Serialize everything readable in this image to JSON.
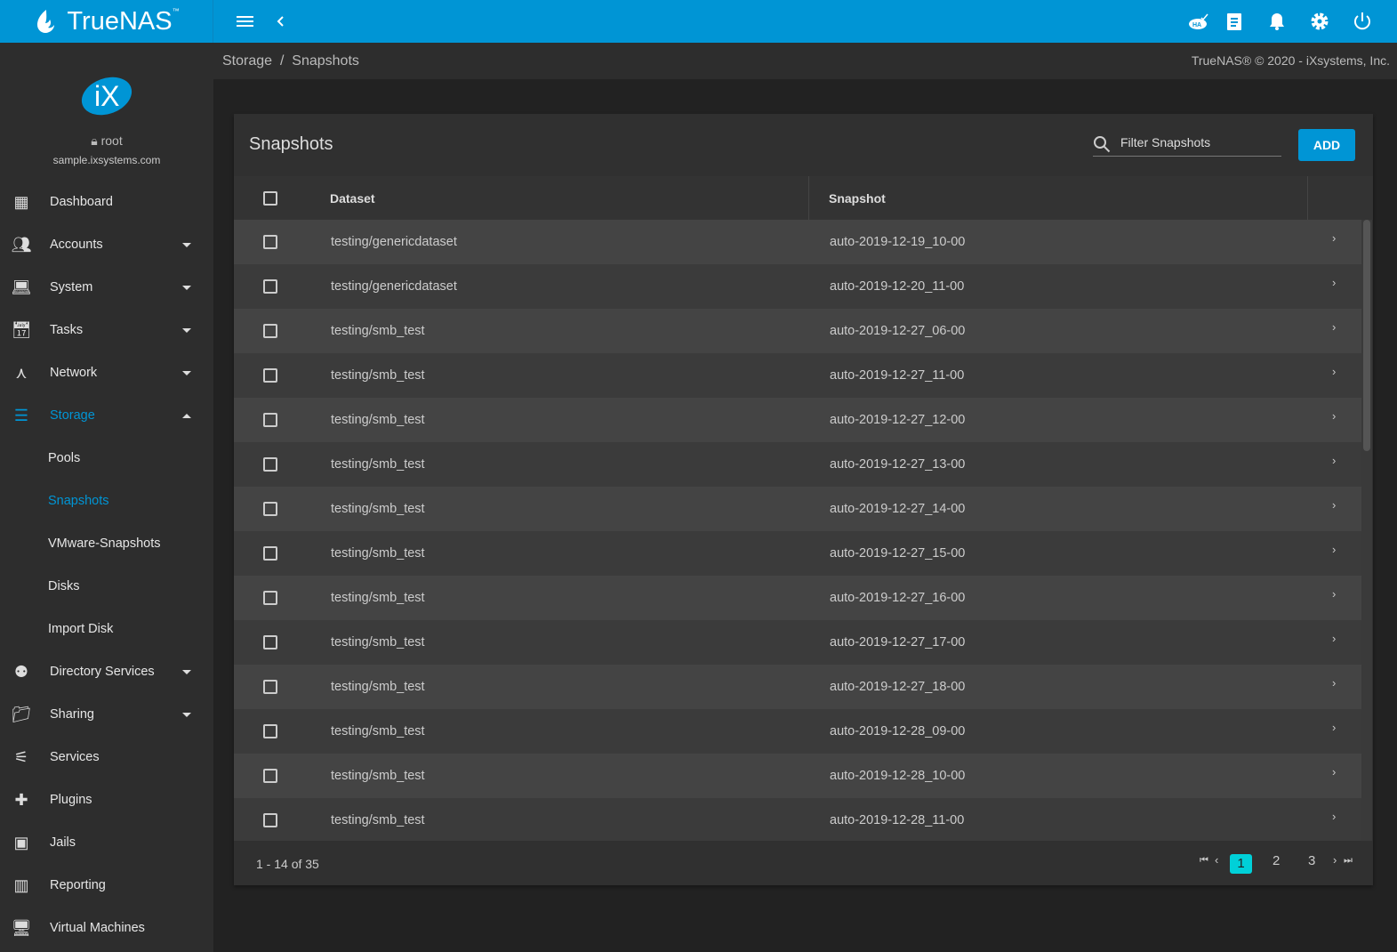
{
  "topbar": {
    "brand": "TrueNAS",
    "trademark": "™",
    "icons": [
      "ha-icon",
      "clipboard-icon",
      "bell-icon",
      "gear-icon",
      "power-icon"
    ],
    "accent": "#0095d5"
  },
  "profile": {
    "logo": "iX",
    "user": "root",
    "host": "sample.ixsystems.com"
  },
  "sidebar": {
    "items": [
      {
        "label": "Dashboard",
        "icon": "dashboard-icon"
      },
      {
        "label": "Accounts",
        "icon": "accounts-icon",
        "expandable": true
      },
      {
        "label": "System",
        "icon": "laptop-icon",
        "expandable": true
      },
      {
        "label": "Tasks",
        "icon": "calendar-icon",
        "expandable": true
      },
      {
        "label": "Network",
        "icon": "network-icon",
        "expandable": true
      },
      {
        "label": "Storage",
        "icon": "storage-icon",
        "expandable": true,
        "expanded": true,
        "active": true
      },
      {
        "label": "Directory Services",
        "icon": "directory-icon",
        "expandable": true
      },
      {
        "label": "Sharing",
        "icon": "folder-shared-icon",
        "expandable": true
      },
      {
        "label": "Services",
        "icon": "tune-icon"
      },
      {
        "label": "Plugins",
        "icon": "puzzle-icon"
      },
      {
        "label": "Jails",
        "icon": "jail-icon"
      },
      {
        "label": "Reporting",
        "icon": "chart-icon"
      },
      {
        "label": "Virtual Machines",
        "icon": "computer-icon"
      }
    ],
    "storage_sub": [
      {
        "label": "Pools"
      },
      {
        "label": "Snapshots",
        "active": true
      },
      {
        "label": "VMware-Snapshots"
      },
      {
        "label": "Disks"
      },
      {
        "label": "Import Disk"
      }
    ]
  },
  "breadcrumb": {
    "parent": "Storage",
    "separator": "/",
    "current": "Snapshots"
  },
  "copyright": "TrueNAS® © 2020 - iXsystems, Inc.",
  "card": {
    "title": "Snapshots",
    "filter_placeholder": "Filter Snapshots",
    "add_label": "ADD"
  },
  "table": {
    "columns": [
      "Dataset",
      "Snapshot"
    ],
    "rows": [
      {
        "dataset": "testing/genericdataset",
        "snapshot": "auto-2019-12-19_10-00"
      },
      {
        "dataset": "testing/genericdataset",
        "snapshot": "auto-2019-12-20_11-00"
      },
      {
        "dataset": "testing/smb_test",
        "snapshot": "auto-2019-12-27_06-00"
      },
      {
        "dataset": "testing/smb_test",
        "snapshot": "auto-2019-12-27_11-00"
      },
      {
        "dataset": "testing/smb_test",
        "snapshot": "auto-2019-12-27_12-00"
      },
      {
        "dataset": "testing/smb_test",
        "snapshot": "auto-2019-12-27_13-00"
      },
      {
        "dataset": "testing/smb_test",
        "snapshot": "auto-2019-12-27_14-00"
      },
      {
        "dataset": "testing/smb_test",
        "snapshot": "auto-2019-12-27_15-00"
      },
      {
        "dataset": "testing/smb_test",
        "snapshot": "auto-2019-12-27_16-00"
      },
      {
        "dataset": "testing/smb_test",
        "snapshot": "auto-2019-12-27_17-00"
      },
      {
        "dataset": "testing/smb_test",
        "snapshot": "auto-2019-12-27_18-00"
      },
      {
        "dataset": "testing/smb_test",
        "snapshot": "auto-2019-12-28_09-00"
      },
      {
        "dataset": "testing/smb_test",
        "snapshot": "auto-2019-12-28_10-00"
      },
      {
        "dataset": "testing/smb_test",
        "snapshot": "auto-2019-12-28_11-00"
      }
    ]
  },
  "pagination": {
    "range": "1 - 14 of 35",
    "pages": [
      "1",
      "2",
      "3"
    ],
    "current": "1",
    "current_color": "#00d0d8"
  }
}
